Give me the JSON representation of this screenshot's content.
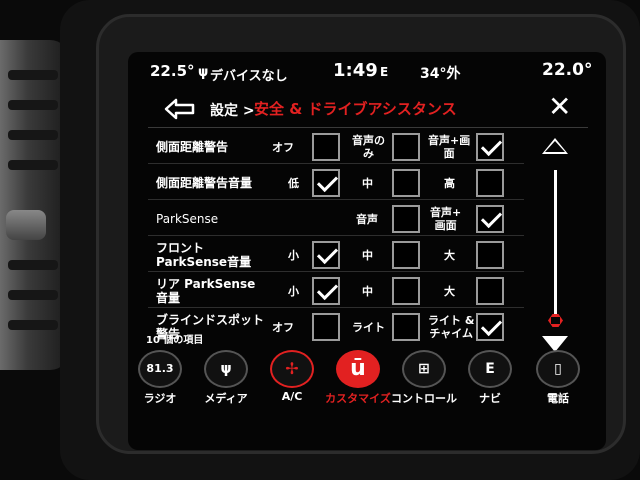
{
  "status": {
    "temp_left": "22.5°",
    "usb_icon": "usb-icon",
    "device": "デバイスなし",
    "time": "1:49",
    "compass": "E",
    "outside": "34°外",
    "temp_right": "22.0°"
  },
  "header": {
    "breadcrumb": "設定 >",
    "title": "安全 & ドライブアシスタンス",
    "close": "✕"
  },
  "rows": [
    {
      "label": "側面距離警告",
      "options": [
        {
          "label": "オフ",
          "checked": false
        },
        {
          "label": "音声の\nみ",
          "checked": false
        },
        {
          "label": "音声+画\n面",
          "checked": true
        }
      ]
    },
    {
      "label": "側面距離警告音量",
      "options": [
        {
          "label": "低",
          "checked": true
        },
        {
          "label": "中",
          "checked": false
        },
        {
          "label": "高",
          "checked": false
        }
      ]
    },
    {
      "label": "ParkSense",
      "options": [
        {
          "label": "音声",
          "checked": false
        },
        {
          "label": "音声+\n画面",
          "checked": true
        }
      ]
    },
    {
      "label": "フロント\nParkSense音量",
      "options": [
        {
          "label": "小",
          "checked": true
        },
        {
          "label": "中",
          "checked": false
        },
        {
          "label": "大",
          "checked": false
        }
      ]
    },
    {
      "label": "リア ParkSense\n音量",
      "options": [
        {
          "label": "小",
          "checked": true
        },
        {
          "label": "中",
          "checked": false
        },
        {
          "label": "大",
          "checked": false
        }
      ]
    },
    {
      "label": "ブラインドスポット\n警告",
      "options": [
        {
          "label": "オフ",
          "checked": false
        },
        {
          "label": "ライト",
          "checked": false
        },
        {
          "label": "ライト &\nチャイム",
          "checked": true
        }
      ]
    }
  ],
  "item_count": "10 個の項目",
  "dock": [
    {
      "id": "radio",
      "icon_text": "81.3",
      "label": "ラジオ",
      "icon": "radio-icon"
    },
    {
      "id": "media",
      "icon_text": "ψ",
      "label": "メディア",
      "icon": "usb-media-icon"
    },
    {
      "id": "ac",
      "icon_text": "✢",
      "label": "A/C",
      "icon": "fan-icon"
    },
    {
      "id": "customize",
      "icon_text": "ū",
      "label": "カスタマイズ",
      "icon": "uconnect-icon"
    },
    {
      "id": "controls",
      "icon_text": "⊞",
      "label": "コントロール",
      "icon": "seat-heat-icon"
    },
    {
      "id": "navi",
      "icon_text": "E",
      "label": "ナビ",
      "icon": "compass-icon"
    },
    {
      "id": "phone",
      "icon_text": "▯",
      "label": "電話",
      "icon": "phone-icon"
    }
  ],
  "colors": {
    "accent": "#e22121",
    "background": "#050505",
    "text": "#ffffff"
  }
}
